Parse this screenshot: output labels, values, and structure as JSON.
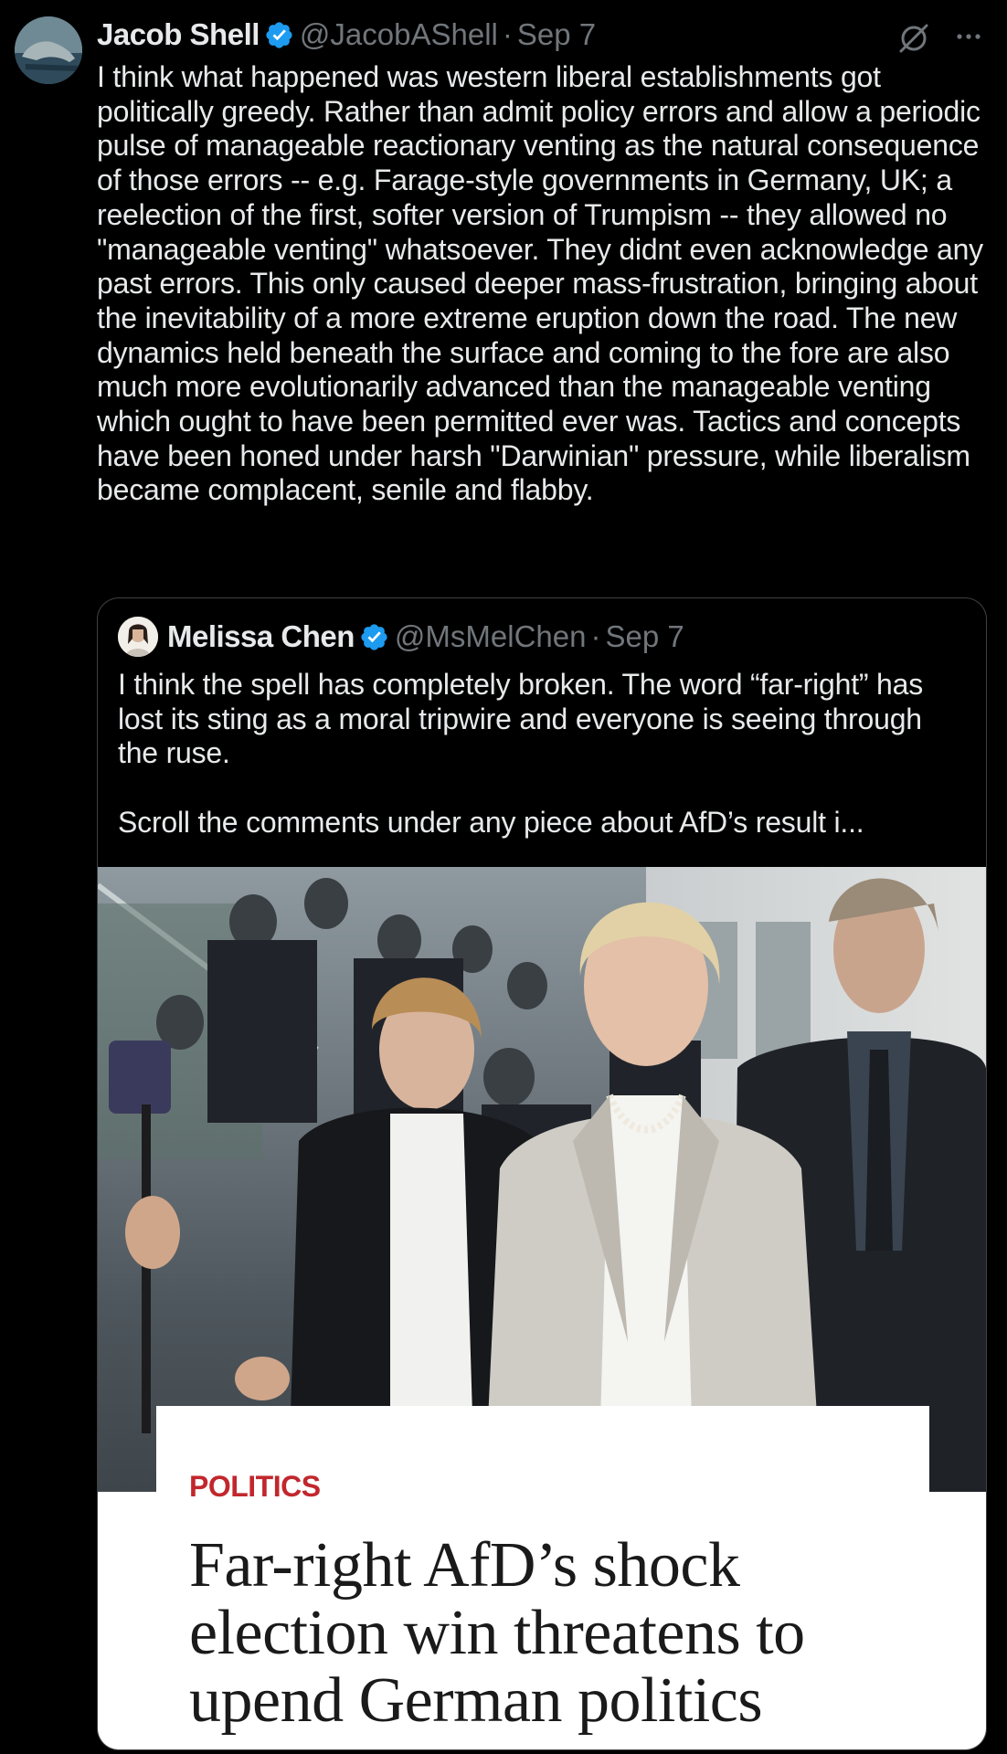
{
  "tweet": {
    "author_name": "Jacob Shell",
    "handle": "@JacobAShell",
    "separator": "·",
    "date": "Sep 7",
    "text": "I think what happened was western liberal establishments got politically greedy. Rather than admit policy errors and allow a periodic pulse of manageable reactionary venting as the natural consequence of those errors -- e.g. Farage-style governments in Germany, UK; a reelection of the first, softer version of Trumpism -- they allowed no \"manageable venting\" whatsoever. They didnt even acknowledge any past errors. This only caused deeper mass-frustration, bringing about the inevitability of a more extreme eruption down the road. The new dynamics held beneath the surface and coming to the fore are also much more evolutionarily advanced than the manageable venting which ought to have been permitted ever was. Tactics and concepts have been honed under harsh \"Darwinian\" pressure, while liberalism became complacent, senile and flabby."
  },
  "quoted_tweet": {
    "author_name": "Melissa Chen",
    "handle": "@MsMelChen",
    "separator": "·",
    "date": "Sep 7",
    "text": "I think the spell has completely broken. The word “far-right” has lost its sting as a moral tripwire and everyone is seeing through the ruse.\n\nScroll the comments under any piece about AfD’s result i..."
  },
  "article_card": {
    "section": "POLITICS",
    "headline": "Far-right AfD’s shock election win threatens to upend German politics"
  },
  "icons": {
    "verified": "verified-badge-icon",
    "grok": "grok-icon",
    "more": "more-options-icon"
  },
  "colors": {
    "background": "#000000",
    "text_primary": "#e7e9ea",
    "text_secondary": "#71767b",
    "verified_blue": "#1d9bf0",
    "section_red": "#c1272d"
  }
}
